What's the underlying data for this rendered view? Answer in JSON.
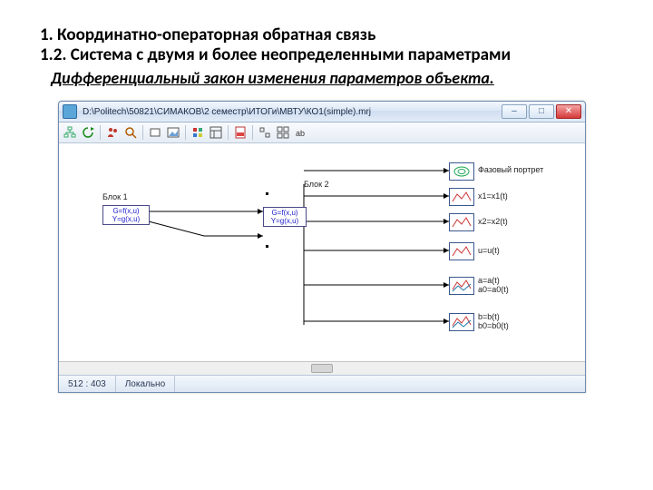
{
  "headings": {
    "h1": "1. Координатно-операторная обратная связь",
    "h2": "1.2. Система с двумя и более неопределенными параметрами",
    "subtitle": "Дифференциальный закон изменения параметров объекта."
  },
  "window": {
    "title": "D:\\Politech\\50821\\СИМАКОВ\\2 семестр\\ИТОГи\\МВТУ\\КО1(simple).mrj",
    "buttons": {
      "min": "–",
      "max": "□",
      "close": "✕"
    }
  },
  "blocks": {
    "b1_label": "Блок 1",
    "b1_line1": "G=f(x,u)",
    "b1_line2": "Y=g(x,u)",
    "b2_label": "Блок 2",
    "b2_line1": "G=f(x,u)",
    "b2_line2": "Y=g(x,u)"
  },
  "outputs": [
    "Фазовый портрет",
    "x1=x1(t)",
    "x2=x2(t)",
    "u=u(t)",
    "a=a(t)\na0=a0(t)",
    "b=b(t)\nb0=b0(t)"
  ],
  "status": {
    "size": "512 : 403",
    "mode": "Локально"
  }
}
